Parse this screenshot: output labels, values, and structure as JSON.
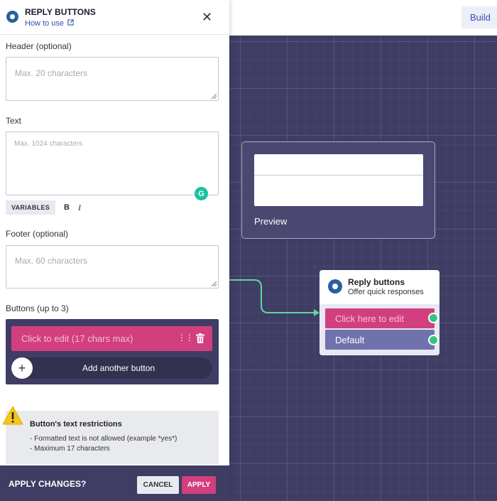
{
  "topbar": {
    "build_label": "Build"
  },
  "canvas": {
    "preview": {
      "label": "Preview"
    },
    "node": {
      "title": "Reply buttons",
      "subtitle": "Offer quick responses",
      "buttons": [
        {
          "label": "Click here to edit"
        },
        {
          "label": "Default"
        }
      ]
    }
  },
  "panel": {
    "title": "REPLY BUTTONS",
    "how_to_use": "How to use",
    "header_field": {
      "label": "Header (optional)",
      "placeholder": "Max. 20 characters"
    },
    "text_field": {
      "label": "Text",
      "placeholder": "Max. 1024 characters"
    },
    "format": {
      "variables": "VARIABLES",
      "bold": "B",
      "italic": "I"
    },
    "footer_field": {
      "label": "Footer (optional)",
      "placeholder": "Max. 60 characters"
    },
    "buttons_section": {
      "label": "Buttons (up to 3)",
      "button_placeholder": "Click to edit (17 chars max)",
      "add_another": "Add another button"
    },
    "notice": {
      "title": "Button's text restrictions",
      "lines": [
        "- Formatted text is not allowed (example *yes*)",
        "- Maximum 17 characters"
      ]
    },
    "footer": {
      "label": "APPLY CHANGES?",
      "cancel": "CANCEL",
      "apply": "APPLY"
    }
  },
  "colors": {
    "accent": "#d23f7f",
    "canvas": "#3f3d64",
    "success": "#35c37f",
    "link": "#2e4fb5"
  }
}
